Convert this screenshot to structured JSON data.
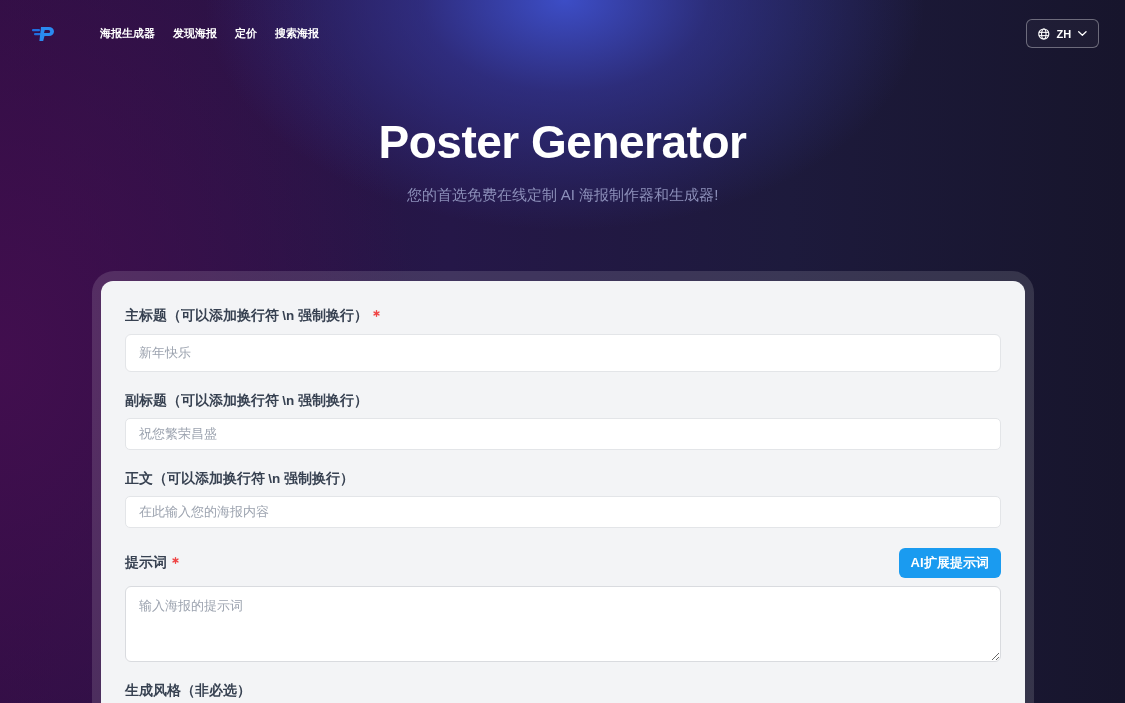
{
  "nav": {
    "links": [
      {
        "label": "海报生成器"
      },
      {
        "label": "发现海报"
      },
      {
        "label": "定价"
      },
      {
        "label": "搜索海报"
      }
    ],
    "language": {
      "label": "ZH"
    }
  },
  "hero": {
    "title": "Poster Generator",
    "subtitle": "您的首选免费在线定制 AI 海报制作器和生成器!"
  },
  "form": {
    "fields": [
      {
        "kind": "input",
        "label": "主标题（可以添加换行符 \\n 强制换行）",
        "required": true,
        "placeholder": "新年快乐"
      },
      {
        "kind": "input",
        "label": "副标题（可以添加换行符 \\n 强制换行）",
        "required": false,
        "placeholder": "祝您繁荣昌盛"
      },
      {
        "kind": "input",
        "label": "正文（可以添加换行符 \\n 强制换行）",
        "required": false,
        "placeholder": "在此输入您的海报内容"
      },
      {
        "kind": "textarea",
        "label": "提示词",
        "required": true,
        "placeholder": "输入海报的提示词",
        "action": "AI扩展提示词"
      },
      {
        "kind": "label",
        "label": "生成风格（非必选）",
        "required": false
      }
    ]
  }
}
